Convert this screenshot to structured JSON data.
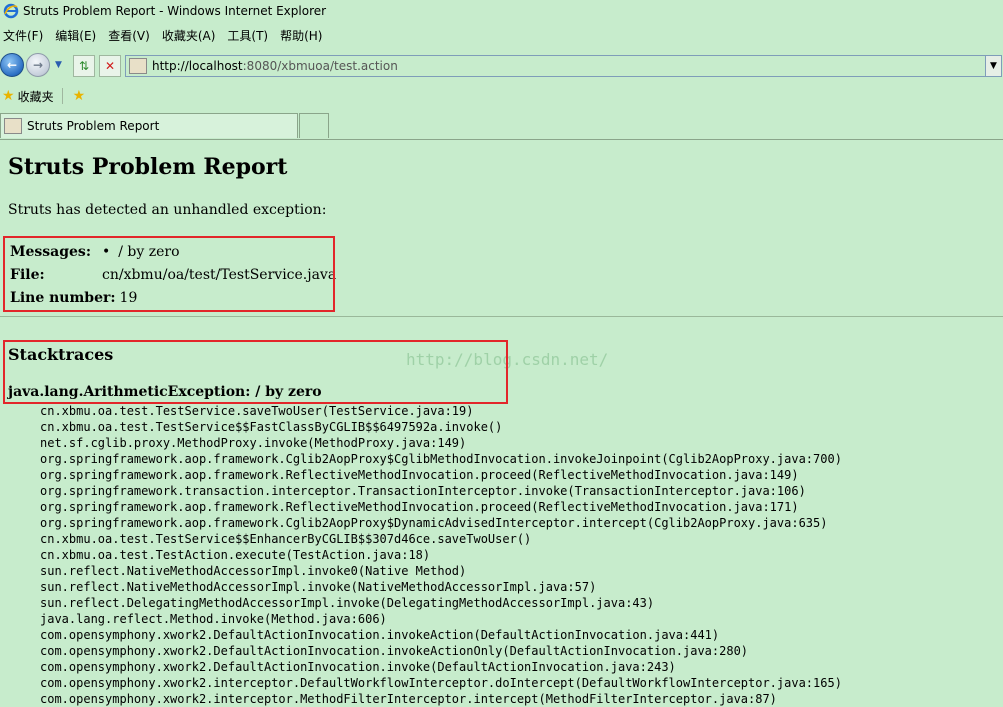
{
  "window": {
    "title": "Struts Problem Report - Windows Internet Explorer"
  },
  "menu": [
    "文件(F)",
    "编辑(E)",
    "查看(V)",
    "收藏夹(A)",
    "工具(T)",
    "帮助(H)"
  ],
  "address": {
    "host": "http://localhost",
    "rest": ":8080/xbmuoa/test.action"
  },
  "favorites": {
    "label": "收藏夹"
  },
  "tab": {
    "label": "Struts Problem Report"
  },
  "page": {
    "heading": "Struts Problem Report",
    "intro": "Struts has detected an unhandled exception:",
    "messages_label": "Messages:",
    "messages_value": "/ by zero",
    "file_label": "File:",
    "file_value": "cn/xbmu/oa/test/TestService.java",
    "line_label": "Line number:",
    "line_value": "19",
    "stack_heading": "Stacktraces",
    "exception": "java.lang.ArithmeticException: / by zero",
    "watermark": "http://blog.csdn.net/",
    "trace": [
      "cn.xbmu.oa.test.TestService.saveTwoUser(TestService.java:19)",
      "cn.xbmu.oa.test.TestService$$FastClassByCGLIB$$6497592a.invoke()",
      "net.sf.cglib.proxy.MethodProxy.invoke(MethodProxy.java:149)",
      "org.springframework.aop.framework.Cglib2AopProxy$CglibMethodInvocation.invokeJoinpoint(Cglib2AopProxy.java:700)",
      "org.springframework.aop.framework.ReflectiveMethodInvocation.proceed(ReflectiveMethodInvocation.java:149)",
      "org.springframework.transaction.interceptor.TransactionInterceptor.invoke(TransactionInterceptor.java:106)",
      "org.springframework.aop.framework.ReflectiveMethodInvocation.proceed(ReflectiveMethodInvocation.java:171)",
      "org.springframework.aop.framework.Cglib2AopProxy$DynamicAdvisedInterceptor.intercept(Cglib2AopProxy.java:635)",
      "cn.xbmu.oa.test.TestService$$EnhancerByCGLIB$$307d46ce.saveTwoUser()",
      "cn.xbmu.oa.test.TestAction.execute(TestAction.java:18)",
      "sun.reflect.NativeMethodAccessorImpl.invoke0(Native Method)",
      "sun.reflect.NativeMethodAccessorImpl.invoke(NativeMethodAccessorImpl.java:57)",
      "sun.reflect.DelegatingMethodAccessorImpl.invoke(DelegatingMethodAccessorImpl.java:43)",
      "java.lang.reflect.Method.invoke(Method.java:606)",
      "com.opensymphony.xwork2.DefaultActionInvocation.invokeAction(DefaultActionInvocation.java:441)",
      "com.opensymphony.xwork2.DefaultActionInvocation.invokeActionOnly(DefaultActionInvocation.java:280)",
      "com.opensymphony.xwork2.DefaultActionInvocation.invoke(DefaultActionInvocation.java:243)",
      "com.opensymphony.xwork2.interceptor.DefaultWorkflowInterceptor.doIntercept(DefaultWorkflowInterceptor.java:165)",
      "com.opensymphony.xwork2.interceptor.MethodFilterInterceptor.intercept(MethodFilterInterceptor.java:87)"
    ]
  },
  "colors": {
    "background": "#c7eccc",
    "highlight_box": "#e2262a"
  }
}
